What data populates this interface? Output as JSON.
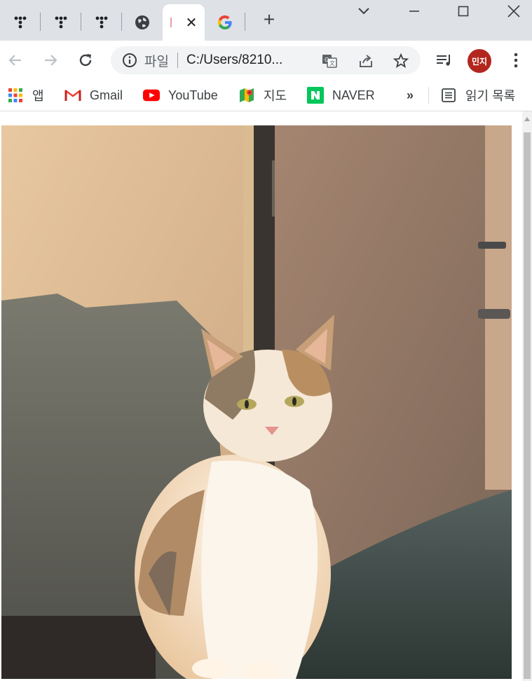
{
  "browser": {
    "tabs": [
      {
        "icon": "t-logo-icon",
        "active": false
      },
      {
        "icon": "t-logo-icon",
        "active": false
      },
      {
        "icon": "t-logo-icon",
        "active": false
      },
      {
        "icon": "globe-icon",
        "active": false
      },
      {
        "icon": "image-file-icon",
        "active": true,
        "close_label": "✕"
      },
      {
        "icon": "google-icon",
        "active": false
      }
    ],
    "new_tab_label": "+",
    "omnibox": {
      "scheme_label": "파일",
      "url": "C:/Users/8210..."
    },
    "profile_label": "민지",
    "colors": {
      "tabstrip": "#dee1e6",
      "profile": "#b3261e",
      "youtube": "#ff0000",
      "naver": "#03c75a"
    }
  },
  "bookmarks": {
    "items": [
      {
        "label": "앱",
        "icon": "apps-grid-icon"
      },
      {
        "label": "Gmail",
        "icon": "gmail-icon"
      },
      {
        "label": "YouTube",
        "icon": "youtube-icon"
      },
      {
        "label": "지도",
        "icon": "maps-icon"
      },
      {
        "label": "NAVER",
        "icon": "naver-icon"
      }
    ],
    "overflow_label": "»",
    "reading_list_label": "읽기 목록"
  },
  "content": {
    "image_subject": "calico cat sitting in sunlight"
  }
}
